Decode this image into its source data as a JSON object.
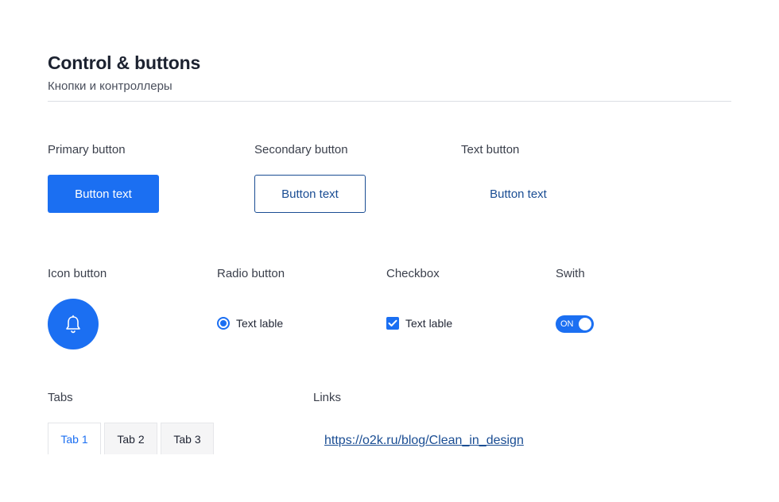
{
  "header": {
    "title": "Control & buttons",
    "subtitle": "Кнопки и контроллеры"
  },
  "buttons": {
    "primary": {
      "label": "Primary button",
      "text": "Button text"
    },
    "secondary": {
      "label": "Secondary button",
      "text": "Button text"
    },
    "text": {
      "label": "Text button",
      "text": "Button text"
    }
  },
  "controls": {
    "icon_button": {
      "label": "Icon button",
      "icon": "bell-icon"
    },
    "radio": {
      "label": "Radio button",
      "text": "Text lable",
      "checked": true
    },
    "checkbox": {
      "label": "Checkbox",
      "text": "Text lable",
      "checked": true
    },
    "switch": {
      "label": "Swith",
      "text": "ON",
      "on": true
    }
  },
  "tabs": {
    "label": "Tabs",
    "items": [
      {
        "label": "Tab 1",
        "active": true
      },
      {
        "label": "Tab 2",
        "active": false
      },
      {
        "label": "Tab 3",
        "active": false
      }
    ]
  },
  "links": {
    "label": "Links",
    "url_text": "https://o2k.ru/blog/Clean_in_design"
  },
  "colors": {
    "primary": "#1b6ff2",
    "link": "#1a4d93",
    "text": "#1c2230"
  }
}
